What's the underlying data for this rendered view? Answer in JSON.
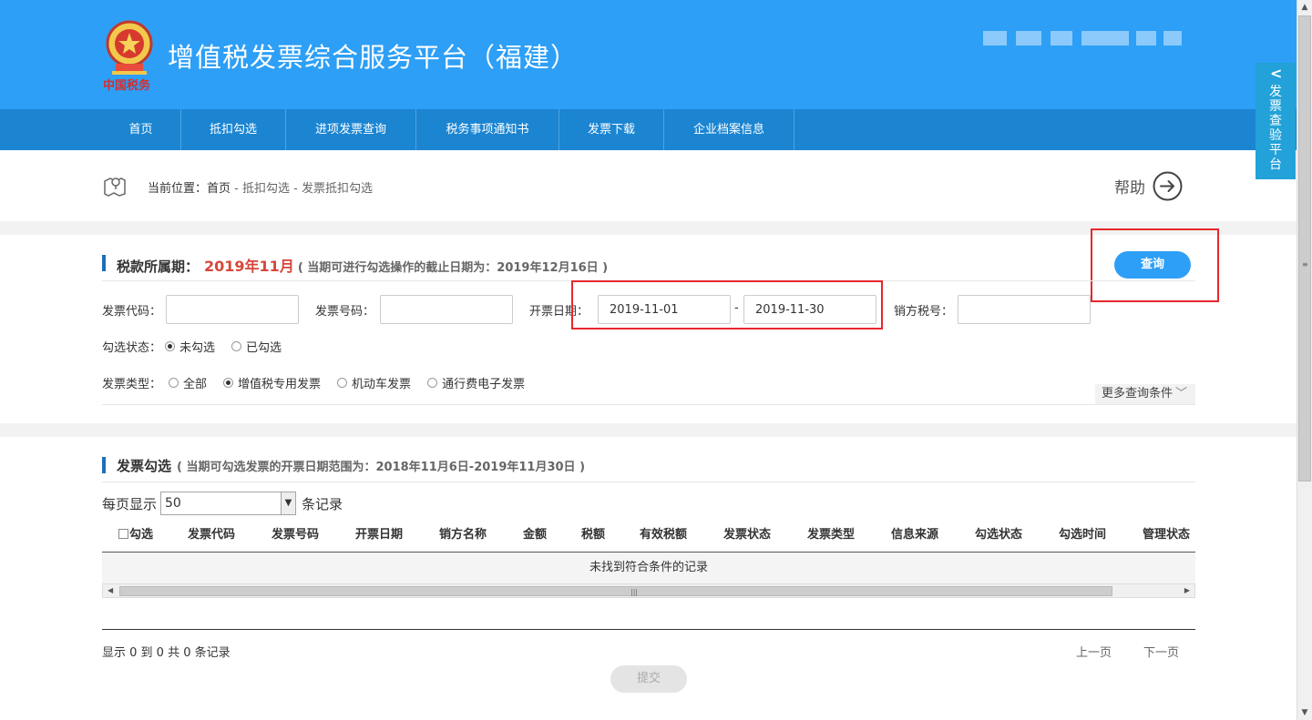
{
  "header": {
    "site_title": "增值税发票综合服务平台（福建）",
    "colors": {
      "header_bg": "#2d9ff6",
      "nav_bg": "#1b85d2",
      "accent_red": "#d7463a",
      "highlight_box": "#e8272c"
    }
  },
  "nav": {
    "items": [
      {
        "label": "首页"
      },
      {
        "label": "抵扣勾选"
      },
      {
        "label": "进项发票查询"
      },
      {
        "label": "税务事项通知书"
      },
      {
        "label": "发票下载"
      },
      {
        "label": "企业档案信息"
      }
    ]
  },
  "side_tab": {
    "arrow": "<",
    "label": "发票查验平台"
  },
  "breadcrumb": {
    "prefix": "当前位置：",
    "items": [
      "首页",
      "抵扣勾选",
      "发票抵扣勾选"
    ],
    "separator": " - ",
    "icon": "location-map-icon"
  },
  "help": {
    "label": "帮助",
    "icon": "arrow-right-circle-icon"
  },
  "query": {
    "title": "税款所属期：",
    "period": "2019年11月",
    "deadline_note": "( 当期可进行勾选操作的截止日期为：2019年12月16日 )",
    "search_button": "查询",
    "fields": {
      "invoice_code_label": "发票代码：",
      "invoice_code_value": "",
      "invoice_number_label": "发票号码：",
      "invoice_number_value": "",
      "issue_date_label": "开票日期：",
      "issue_date_from": "2019-11-01",
      "issue_date_separator": "-",
      "issue_date_to": "2019-11-30",
      "seller_tax_id_label": "销方税号：",
      "seller_tax_id_value": ""
    },
    "check_status": {
      "label": "勾选状态：",
      "options": [
        "未勾选",
        "已勾选"
      ],
      "selected": "未勾选"
    },
    "invoice_type": {
      "label": "发票类型：",
      "options": [
        "全部",
        "增值税专用发票",
        "机动车发票",
        "通行费电子发票"
      ],
      "selected": "增值税专用发票"
    },
    "more_conditions": "更多查询条件",
    "more_icon": "chevron-down-icon"
  },
  "invoice_selection": {
    "title": "发票勾选",
    "range_note": "( 当期可勾选发票的开票日期范围为：2018年11月6日-2019年11月30日 )",
    "page_size_prefix": "每页显示",
    "page_size_value": "50",
    "page_size_suffix": "条记录",
    "columns": [
      "勾选",
      "发票代码",
      "发票号码",
      "开票日期",
      "销方名称",
      "金额",
      "税额",
      "有效税额",
      "发票状态",
      "发票类型",
      "信息来源",
      "勾选状态",
      "勾选时间",
      "管理状态"
    ],
    "empty_message": "未找到符合条件的记录",
    "summary": "显示 0 到 0 共 0 条记录",
    "prev_page": "上一页",
    "next_page": "下一页",
    "submit_button": "提交"
  }
}
